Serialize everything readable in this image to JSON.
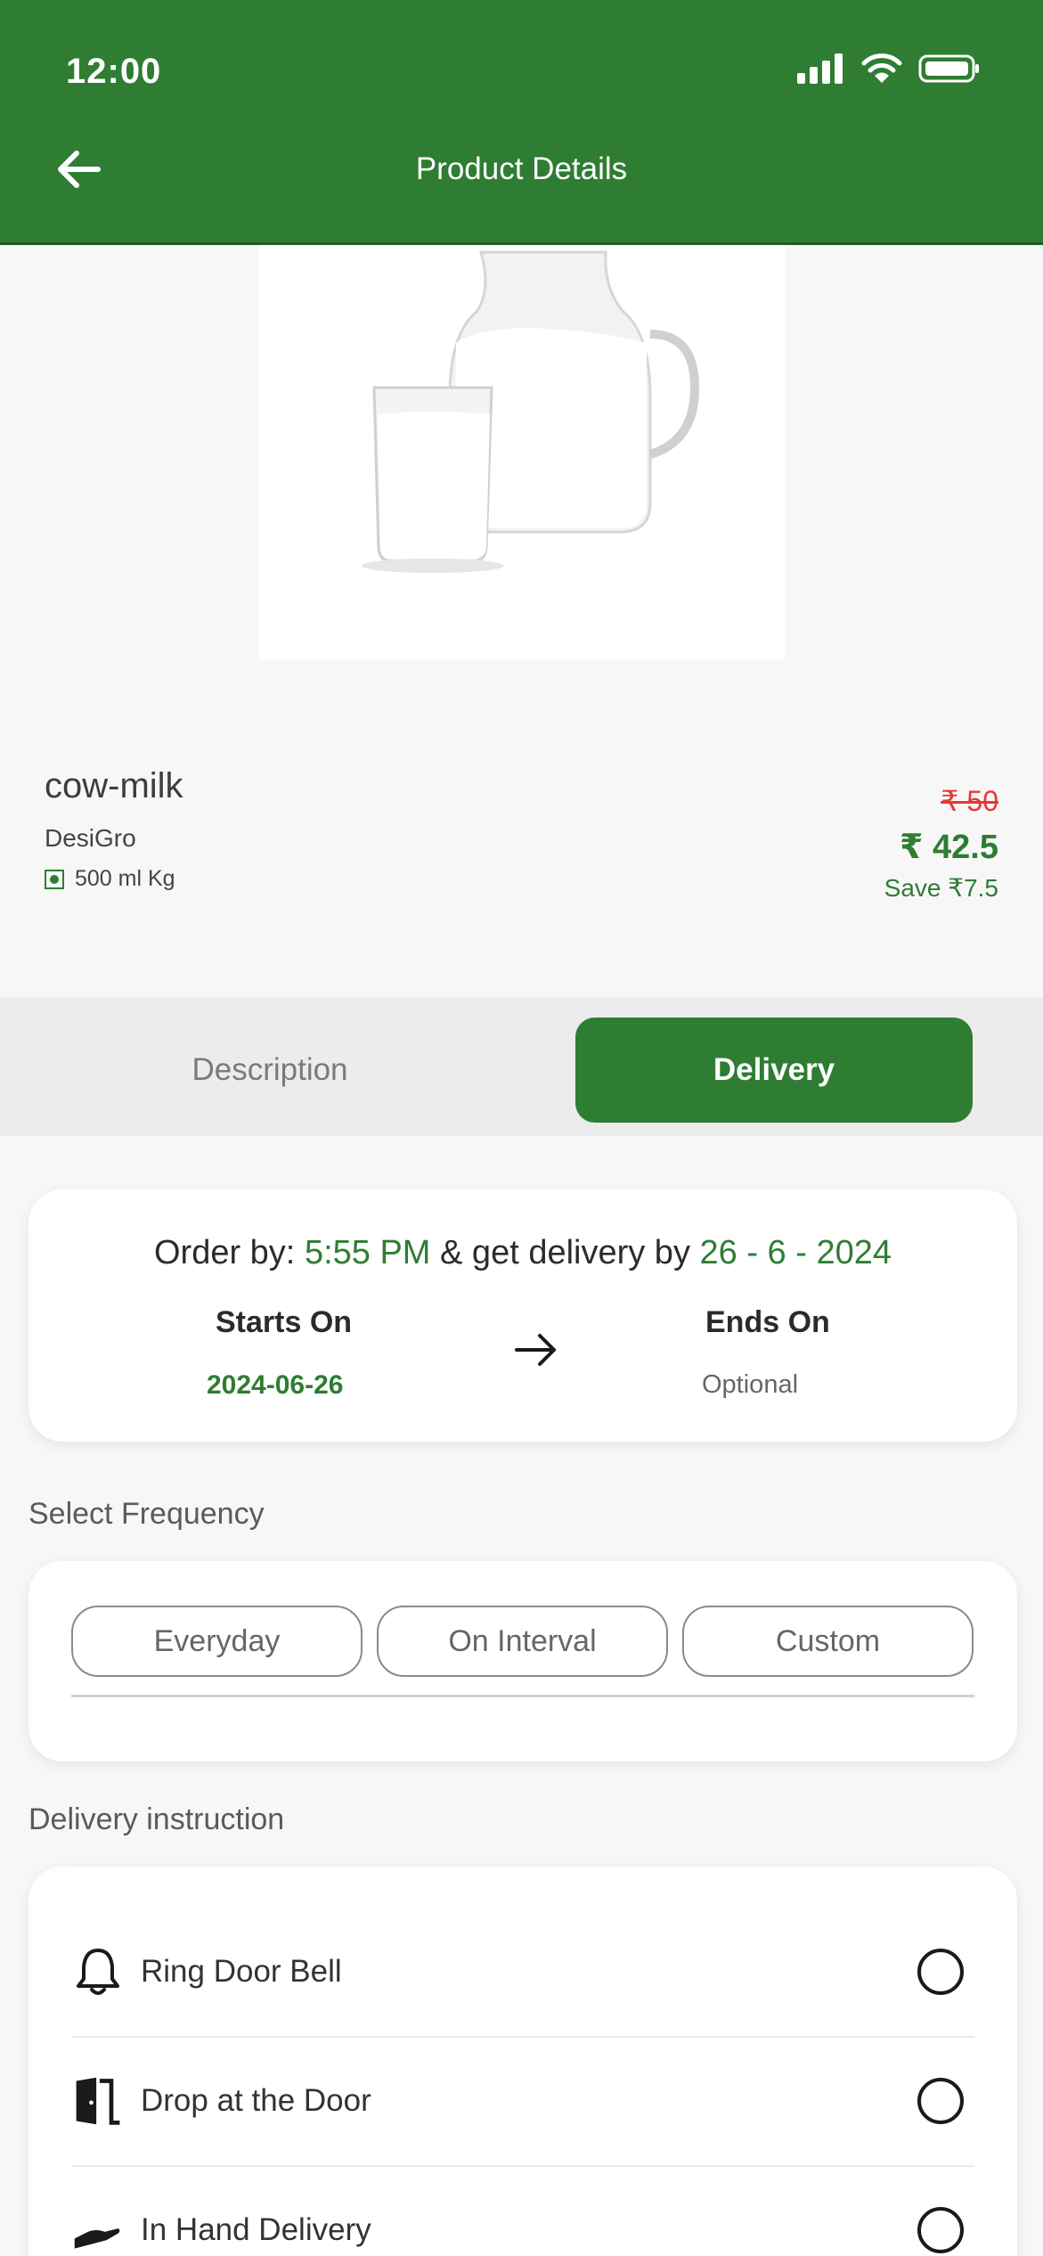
{
  "status_bar": {
    "time": "12:00"
  },
  "header": {
    "title": "Product Details"
  },
  "product": {
    "name": "cow-milk",
    "brand": "DesiGro",
    "quantity": "500 ml Kg",
    "price_old": "₹ 50",
    "price_new": "₹ 42.5",
    "save_text": "Save ₹7.5"
  },
  "tabs": [
    {
      "label": "Description",
      "active": false
    },
    {
      "label": "Delivery",
      "active": true
    }
  ],
  "order_info": {
    "prefix": "Order by: ",
    "time": "5:55 PM",
    "middle": " & get delivery by ",
    "date": "26 - 6 - 2024",
    "starts_label": "Starts On",
    "starts_value": "2024-06-26",
    "ends_label": "Ends On",
    "ends_value": "Optional"
  },
  "frequency": {
    "title": "Select Frequency",
    "options": [
      "Everyday",
      "On Interval",
      "Custom"
    ]
  },
  "instructions": {
    "title": "Delivery instruction",
    "items": [
      {
        "label": "Ring Door Bell",
        "icon": "bell-icon"
      },
      {
        "label": "Drop at the Door",
        "icon": "door-icon"
      },
      {
        "label": "In Hand Delivery",
        "icon": "hand-icon"
      }
    ]
  },
  "colors": {
    "primary": "#2e7d32",
    "strike": "#e53935",
    "background": "#f7f7f8"
  }
}
